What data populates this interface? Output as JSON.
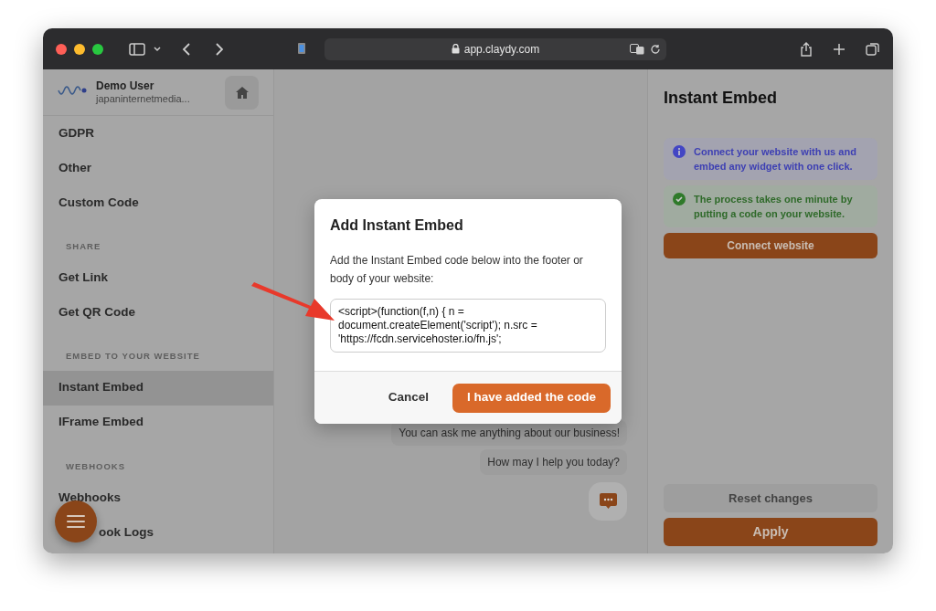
{
  "browser": {
    "url": "app.claydy.com"
  },
  "user": {
    "name": "Demo User",
    "account": "japaninternetmedia..."
  },
  "sidebar": {
    "items": [
      {
        "kind": "item",
        "label": "GDPR",
        "selected": false
      },
      {
        "kind": "item",
        "label": "Other",
        "selected": false
      },
      {
        "kind": "item",
        "label": "Custom Code",
        "selected": false
      },
      {
        "kind": "section",
        "label": "SHARE"
      },
      {
        "kind": "item",
        "label": "Get Link",
        "selected": false
      },
      {
        "kind": "item",
        "label": "Get QR Code",
        "selected": false
      },
      {
        "kind": "section",
        "label": "EMBED TO YOUR WEBSITE"
      },
      {
        "kind": "item",
        "label": "Instant Embed",
        "selected": true
      },
      {
        "kind": "item",
        "label": "IFrame Embed",
        "selected": false
      },
      {
        "kind": "section",
        "label": "WEBHOOKS"
      },
      {
        "kind": "item",
        "label": "Webhooks",
        "selected": false
      },
      {
        "kind": "item",
        "label": "ook Logs",
        "selected": false
      }
    ]
  },
  "chat": {
    "messages": [
      "You can ask me anything about our business!",
      "How may I help you today?"
    ]
  },
  "dialog": {
    "title": "Add Instant Embed",
    "description": "Add the Instant Embed code below into the footer or body of your website:",
    "code": "<script>(function(f,n) { n = document.createElement('script'); n.src = 'https://fcdn.servicehoster.io/fn.js';",
    "buttons": [
      {
        "kind": "secondary",
        "label": "Cancel"
      },
      {
        "kind": "primary",
        "label": "I have added the code"
      }
    ]
  },
  "panel": {
    "title": "Instant Embed",
    "notices": [
      {
        "kind": "info",
        "text": "Connect your website with us and embed any widget with one click."
      },
      {
        "kind": "success",
        "text": "The process takes one minute by putting a code on your website."
      }
    ],
    "connect_button": "Connect website",
    "reset_button": "Reset changes",
    "apply_button": "Apply"
  }
}
